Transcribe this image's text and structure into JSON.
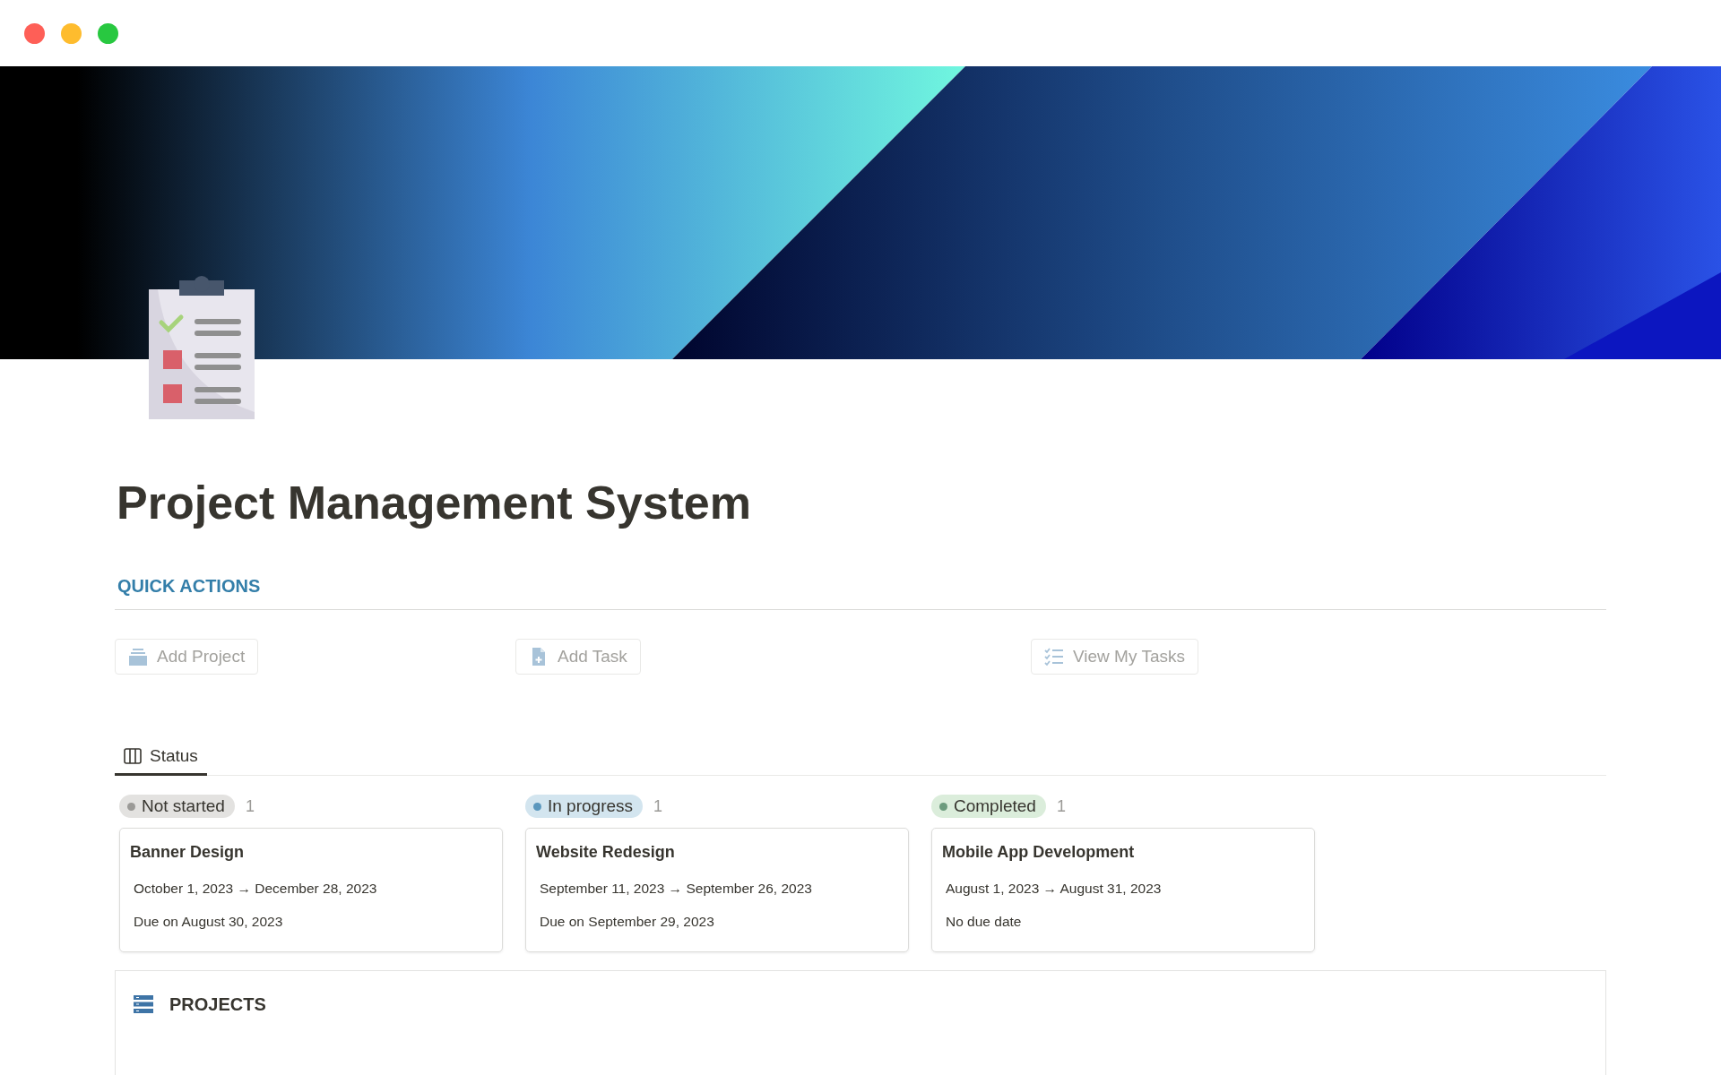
{
  "title": "Project Management System",
  "quick_actions": {
    "heading": "QUICK ACTIONS",
    "buttons": [
      {
        "label": "Add Project",
        "kind": "stack"
      },
      {
        "label": "Add Task",
        "kind": "file"
      },
      {
        "label": "View My Tasks",
        "kind": "checklist"
      }
    ]
  },
  "view_tabs": [
    {
      "label": "Status",
      "selected": true
    }
  ],
  "board": [
    {
      "status": "Not started",
      "color": "#9b9a97",
      "count": "1",
      "cards": [
        {
          "title": "Banner Design",
          "dates": "October 1, 2023 → December 28, 2023",
          "due": "Due on August 30, 2023"
        }
      ]
    },
    {
      "status": "In progress",
      "color": "#5b97bd",
      "count": "1",
      "cards": [
        {
          "title": "Website Redesign",
          "dates": "September 11, 2023 → September 26, 2023",
          "due": "Due on September 29, 2023"
        }
      ]
    },
    {
      "status": "Completed",
      "color": "#6c9b7d",
      "count": "1",
      "cards": [
        {
          "title": "Mobile App Development",
          "dates": "August 1, 2023 → August 31, 2023",
          "due": "No due date"
        }
      ]
    }
  ],
  "projects": {
    "heading": "PROJECTS"
  }
}
